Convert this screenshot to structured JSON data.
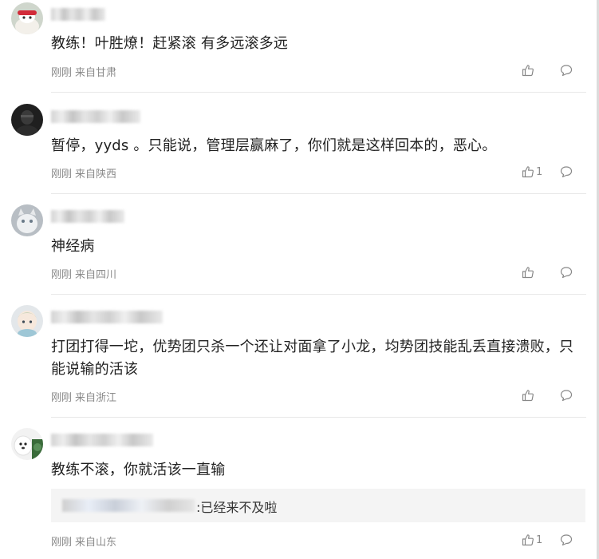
{
  "comments": [
    {
      "text": "教练！叶胜燎！赶紧滚 有多远滚多远",
      "time": "刚刚",
      "location": "来自甘肃",
      "likes": ""
    },
    {
      "text": "暂停，yyds 。只能说，管理层赢麻了，你们就是这样回本的，恶心。",
      "time": "刚刚",
      "location": "来自陕西",
      "likes": "1"
    },
    {
      "text": "神经病",
      "time": "刚刚",
      "location": "来自四川",
      "likes": ""
    },
    {
      "text": "打团打得一坨，优势团只杀一个还让对面拿了小龙，均势团技能乱丢直接溃败，只能说输的活该",
      "time": "刚刚",
      "location": "来自浙江",
      "likes": ""
    },
    {
      "text": "教练不滚，你就活该一直输",
      "time": "刚刚",
      "location": "来自山东",
      "likes": "1",
      "reply": ":已经来不及啦"
    }
  ],
  "icons": {
    "like": "thumbs-up-icon",
    "reply": "comment-bubble-icon"
  },
  "colors": {
    "text": "#222222",
    "meta": "#8a8a8a",
    "reply_bg": "#f4f4f4"
  }
}
